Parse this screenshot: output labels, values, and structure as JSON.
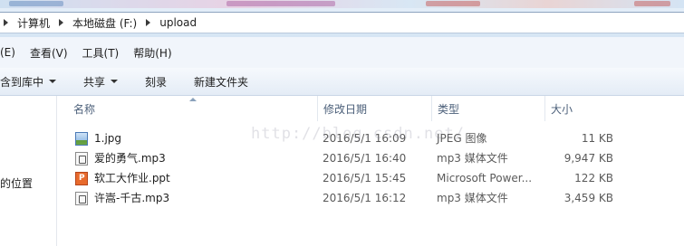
{
  "address_bar": {
    "crumbs": [
      "计算机",
      "本地磁盘 (F:)",
      "upload"
    ]
  },
  "menu": {
    "items": [
      "(E)",
      "查看(V)",
      "工具(T)",
      "帮助(H)"
    ]
  },
  "toolbar": {
    "include_library": "含到库中",
    "share": "共享",
    "burn": "刻录",
    "new_folder": "新建文件夹"
  },
  "nav": {
    "recent_places": "的位置"
  },
  "columns": {
    "name": "名称",
    "date": "修改日期",
    "type": "类型",
    "size": "大小"
  },
  "files": [
    {
      "name": "1.jpg",
      "date": "2016/5/1 16:09",
      "type": "JPEG 图像",
      "size": "11 KB",
      "icon": "image-file-icon"
    },
    {
      "name": "爱的勇气.mp3",
      "date": "2016/5/1 16:40",
      "type": "mp3 媒体文件",
      "size": "9,947 KB",
      "icon": "audio-file-icon"
    },
    {
      "name": "软工大作业.ppt",
      "date": "2016/5/1 15:45",
      "type": "Microsoft Power...",
      "size": "122 KB",
      "icon": "powerpoint-file-icon"
    },
    {
      "name": "许嵩-千古.mp3",
      "date": "2016/5/1 16:12",
      "type": "mp3 媒体文件",
      "size": "3,459 KB",
      "icon": "audio-file-icon"
    }
  ],
  "watermark": "http://blog.csdn.net/",
  "colors": {
    "header_text": "#4c607a",
    "toolbar_bg": "#e4ecf6",
    "address_bg": "#d6e5f4"
  }
}
